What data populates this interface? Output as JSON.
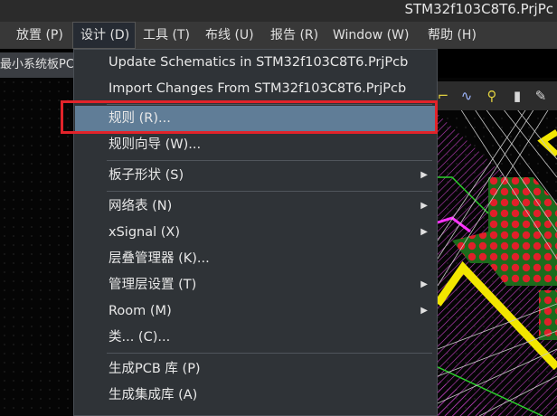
{
  "window": {
    "title": "STM32f103C8T6.PrjPc"
  },
  "menubar": [
    {
      "label": "放置 (P)"
    },
    {
      "label": "设计 (D)"
    },
    {
      "label": "工具 (T)"
    },
    {
      "label": "布线 (U)"
    },
    {
      "label": "报告 (R)"
    },
    {
      "label": "Window (W)"
    },
    {
      "label": "帮助 (H)"
    }
  ],
  "document_tab": {
    "label": "最小系统板PC"
  },
  "design_menu": {
    "items": [
      {
        "label": "Update Schematics in STM32f103C8T6.PrjPcb",
        "submenu": false
      },
      {
        "label": "Import Changes From STM32f103C8T6.PrjPcb",
        "submenu": false
      },
      {
        "label": "规则 (R)...",
        "submenu": false,
        "highlighted": true
      },
      {
        "label": "规则向导 (W)...",
        "submenu": false
      },
      {
        "label": "板子形状 (S)",
        "submenu": true
      },
      {
        "label": "网络表 (N)",
        "submenu": true
      },
      {
        "label": "xSignal (X)",
        "submenu": true
      },
      {
        "label": "层叠管理器 (K)...",
        "submenu": false
      },
      {
        "label": "管理层设置 (T)",
        "submenu": true
      },
      {
        "label": "Room (M)",
        "submenu": true
      },
      {
        "label": "类... (C)...",
        "submenu": false
      },
      {
        "label": "生成PCB 库 (P)",
        "submenu": false
      },
      {
        "label": "生成集成库 (A)",
        "submenu": false
      }
    ]
  },
  "colors": {
    "highlight": "#607d97",
    "annotation_box": "#e2232a",
    "pcb_track_yellow": "#f2e600",
    "pcb_pad_red": "#e0202a",
    "pcb_hatch_magenta": "#c040c0",
    "pcb_outline_green": "#2bd02b"
  },
  "toolbar_icons": [
    "route-icon",
    "wave-icon",
    "key-icon",
    "pad-icon",
    "edit-icon"
  ]
}
